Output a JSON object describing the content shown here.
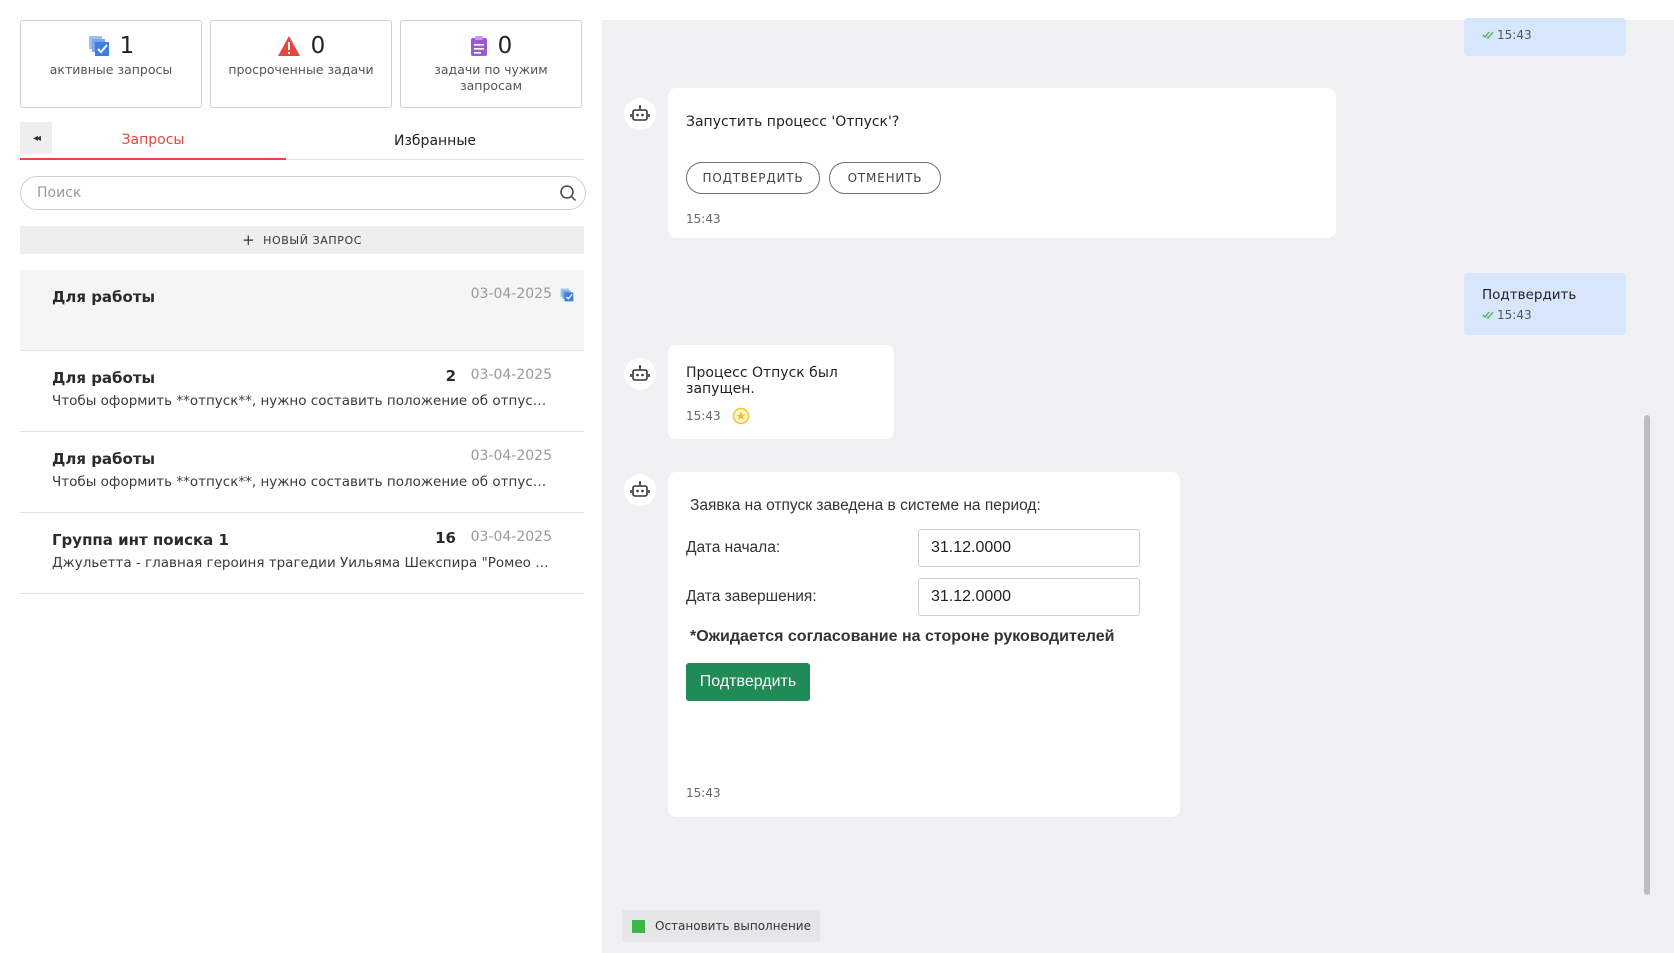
{
  "stats": [
    {
      "count": "1",
      "label": "активные запросы",
      "icon": "stack-check-icon",
      "color": "#3d7fe0"
    },
    {
      "count": "0",
      "label": "просроченные задачи",
      "icon": "warning-triangle-icon",
      "color": "#e4473f"
    },
    {
      "count": "0",
      "label": "задачи по чужим запросам",
      "icon": "clipboard-icon",
      "color": "#9b59d8"
    }
  ],
  "tabs": {
    "requests": "Запросы",
    "favorites": "Избранные",
    "collapse": "◂◂"
  },
  "search": {
    "placeholder": "Поиск"
  },
  "new_request": {
    "plus": "+",
    "label": "НОВЫЙ ЗАПРОС"
  },
  "requests": [
    {
      "title": "Для работы",
      "date": "03-04-2025",
      "count": "",
      "preview": "",
      "flag": "stack-check-icon"
    },
    {
      "title": "Для работы",
      "date": "03-04-2025",
      "count": "2",
      "preview": "Чтобы оформить **отпуск**, нужно составить положение об отпусках, ..."
    },
    {
      "title": "Для работы",
      "date": "03-04-2025",
      "count": "",
      "preview": "Чтобы оформить **отпуск**, нужно составить положение об отпусках, ..."
    },
    {
      "title": "Группа инт поиска 1",
      "date": "03-04-2025",
      "count": "16",
      "preview": "Джульетта - главная героиня трагедии Уильяма Шекспира \"Ромео и Дж..."
    }
  ],
  "chat": {
    "user_msg_1": {
      "time": "15:43"
    },
    "bot_msg_1": {
      "text": "Запустить процесс 'Отпуск'?",
      "confirm": "ПОДТВЕРДИТЬ",
      "cancel": "ОТМЕНИТЬ",
      "time": "15:43"
    },
    "user_msg_2": {
      "text": "Подтвердить",
      "time": "15:43"
    },
    "bot_msg_2": {
      "text": "Процесс Отпуск был запущен.",
      "time": "15:43"
    },
    "bot_msg_3": {
      "intro": "Заявка на отпуск заведена в системе на период:",
      "start_label": "Дата начала:",
      "start_value": "31.12.0000",
      "end_label": "Дата завершения:",
      "end_value": "31.12.0000",
      "note": "*Ожидается согласование на стороне руководителей",
      "button": "Подтвердить",
      "time": "15:43"
    },
    "stop": "Остановить выполнение"
  },
  "colors": {
    "accent": "#e4473f",
    "user_bubble": "#d8e6fb",
    "chat_bg": "#f0f0f2",
    "green": "#218b57",
    "stop": "#3cb54a"
  }
}
